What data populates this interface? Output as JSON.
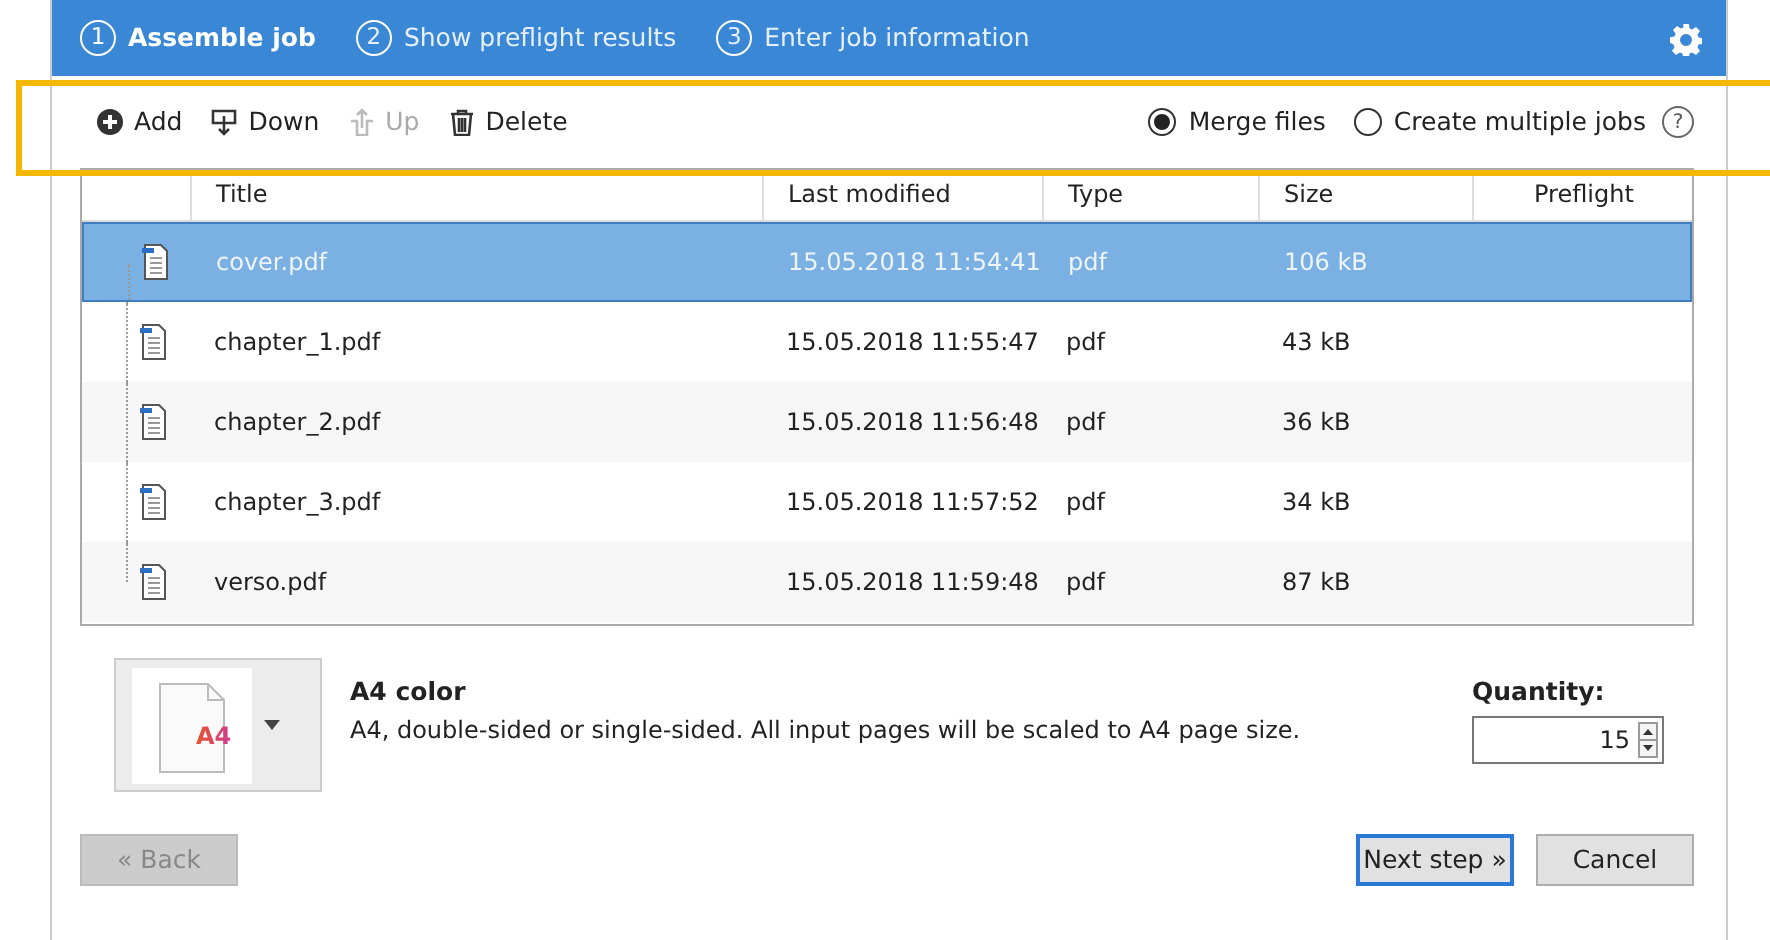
{
  "steps": [
    {
      "number": "1",
      "label": "Assemble job",
      "selected": true
    },
    {
      "number": "2",
      "label": "Show preflight results",
      "selected": false
    },
    {
      "number": "3",
      "label": "Enter job information",
      "selected": false
    }
  ],
  "toolbar": [
    {
      "kind": "add",
      "label": "Add",
      "disabled": false
    },
    {
      "kind": "down",
      "label": "Down",
      "disabled": false
    },
    {
      "kind": "up",
      "label": "Up",
      "disabled": true
    },
    {
      "kind": "delete",
      "label": "Delete",
      "disabled": false
    }
  ],
  "mode_options": [
    {
      "label": "Merge files",
      "selected": true
    },
    {
      "label": "Create multiple jobs",
      "selected": false
    }
  ],
  "help": "?",
  "table": {
    "columns": [
      "Title",
      "Last modified",
      "Type",
      "Size",
      "Preflight"
    ],
    "rows": [
      {
        "title": "cover.pdf",
        "modified": "15.05.2018 11:54:41",
        "type": "pdf",
        "size": "106 kB",
        "selected": true
      },
      {
        "title": "chapter_1.pdf",
        "modified": "15.05.2018 11:55:47",
        "type": "pdf",
        "size": "43 kB",
        "selected": false
      },
      {
        "title": "chapter_2.pdf",
        "modified": "15.05.2018 11:56:48",
        "type": "pdf",
        "size": "36 kB",
        "selected": false
      },
      {
        "title": "chapter_3.pdf",
        "modified": "15.05.2018 11:57:52",
        "type": "pdf",
        "size": "34 kB",
        "selected": false
      },
      {
        "title": "verso.pdf",
        "modified": "15.05.2018 11:59:48",
        "type": "pdf",
        "size": "87 kB",
        "selected": false
      }
    ]
  },
  "paper": {
    "thumbnail": "A4",
    "name": "A4 color",
    "description": "A4, double-sided or single-sided. All input pages will be scaled to A4 page size."
  },
  "quantity": {
    "label": "Quantity:",
    "value": "15"
  },
  "buttons": [
    {
      "label": "« Back",
      "disabled": true,
      "focused": false
    },
    {
      "label": "Next step »",
      "disabled": false,
      "focused": true
    },
    {
      "label": "Cancel",
      "disabled": false,
      "focused": false
    }
  ]
}
